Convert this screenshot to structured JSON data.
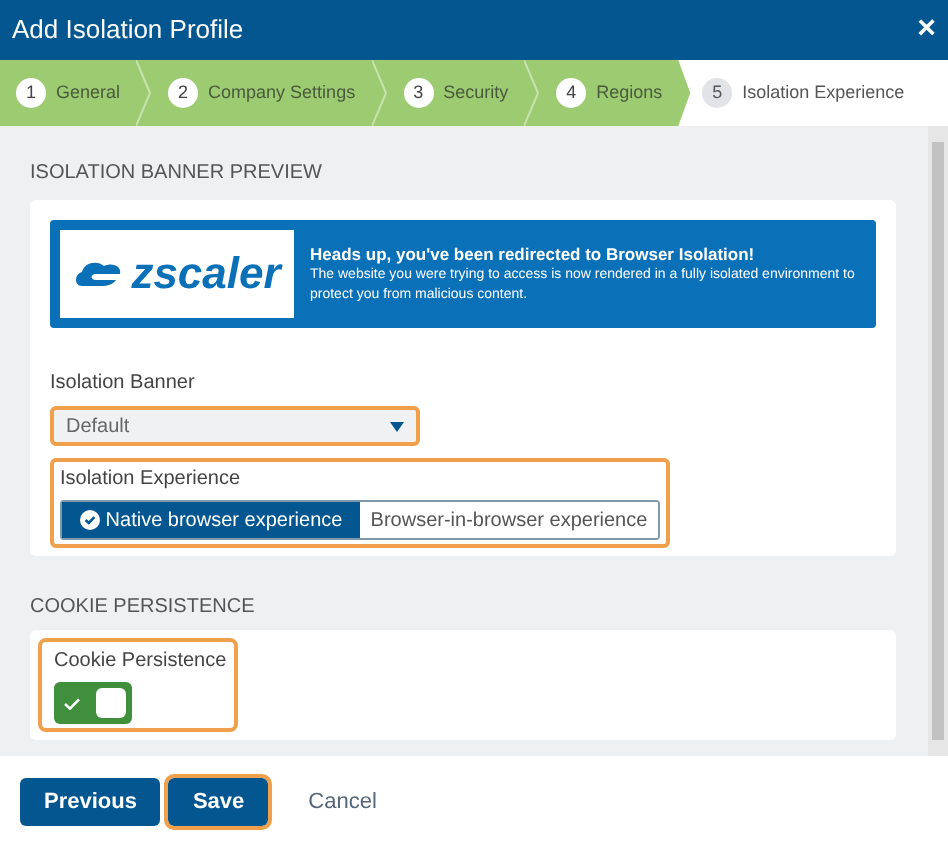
{
  "window": {
    "title": "Add Isolation Profile",
    "close": "×"
  },
  "steps": [
    {
      "number": "1",
      "label": "General",
      "selected": false
    },
    {
      "number": "2",
      "label": "Company Settings",
      "selected": false
    },
    {
      "number": "3",
      "label": "Security",
      "selected": false
    },
    {
      "number": "4",
      "label": "Regions",
      "selected": false
    },
    {
      "number": "5",
      "label": "Isolation Experience",
      "selected": true
    }
  ],
  "banner_section": {
    "title": "ISOLATION BANNER PREVIEW",
    "banner": {
      "logo_text": "zscaler",
      "heading": "Heads up, you've been redirected to Browser Isolation!",
      "body": "The website you were trying to access is now rendered in a fully isolated environment to protect you from malicious content."
    },
    "isolation_banner": {
      "label": "Isolation Banner",
      "value": "Default",
      "highlighted": true
    },
    "isolation_experience": {
      "label": "Isolation Experience",
      "highlighted": true,
      "options": [
        {
          "label": "Native browser experience",
          "selected": true
        },
        {
          "label": "Browser-in-browser experience",
          "selected": false
        }
      ]
    }
  },
  "cookie_section": {
    "title": "COOKIE PERSISTENCE",
    "toggle": {
      "label": "Cookie Persistence",
      "on": true,
      "highlighted": true
    }
  },
  "buttons": [
    {
      "label": "Previous",
      "kind": "primary",
      "highlighted": false
    },
    {
      "label": "Save",
      "kind": "primary",
      "highlighted": true
    },
    {
      "label": "Cancel",
      "kind": "link",
      "highlighted": false
    }
  ]
}
